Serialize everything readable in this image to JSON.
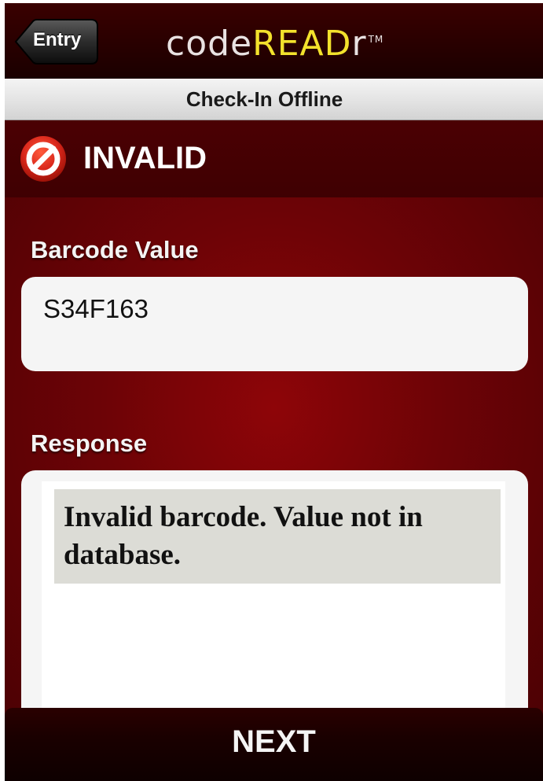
{
  "navbar": {
    "back_label": "Entry",
    "logo_code": "code",
    "logo_read": "READ",
    "logo_r": "r",
    "logo_tm": "TM"
  },
  "subbar": {
    "title": "Check-In Offline"
  },
  "status": {
    "text": "INVALID",
    "icon": "no-entry-icon",
    "icon_color": "#d8261a"
  },
  "barcode": {
    "label": "Barcode Value",
    "value": "S34F163"
  },
  "response": {
    "label": "Response",
    "message": "Invalid barcode. Value not in database."
  },
  "footer": {
    "next_label": "NEXT"
  },
  "colors": {
    "brand_yellow": "#f3e22c",
    "background_red": "#7a0307"
  }
}
